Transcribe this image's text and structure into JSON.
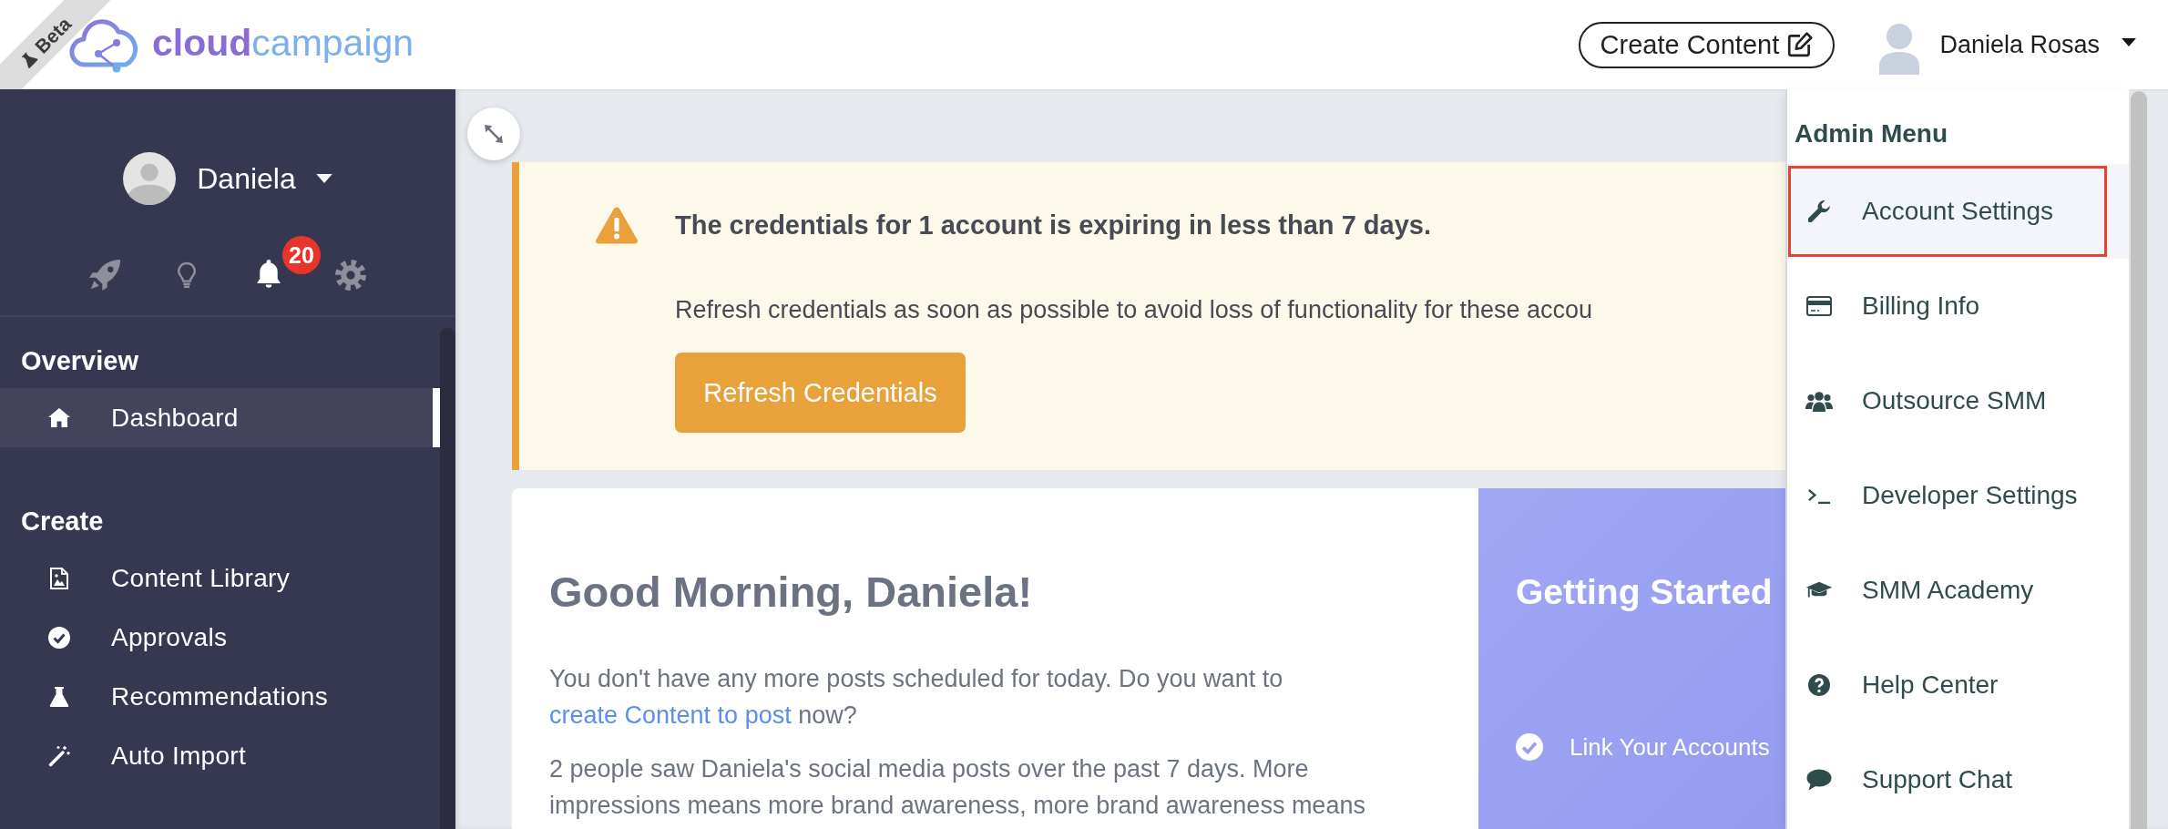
{
  "header": {
    "badge": "Beta",
    "brand": "**cloud**campaign",
    "create_button": "Create Content",
    "user_name": "Daniela Rosas"
  },
  "sidebar": {
    "profile_name": "Daniela",
    "quick_actions": [
      {
        "kind": "rocket",
        "active": false
      },
      {
        "kind": "bulb",
        "active": false
      },
      {
        "kind": "bell",
        "active": true,
        "badge": "20"
      },
      {
        "kind": "gear",
        "active": false
      }
    ],
    "sections": [
      {
        "title": "Overview",
        "items": [
          {
            "label": "Dashboard",
            "kind": "home",
            "selected": true
          }
        ]
      },
      {
        "title": "Create",
        "items": [
          {
            "label": "Content Library",
            "kind": "image",
            "selected": false
          },
          {
            "label": "Approvals",
            "kind": "check",
            "selected": false
          },
          {
            "label": "Recommendations",
            "kind": "flask",
            "selected": false
          },
          {
            "label": "Auto Import",
            "kind": "wand",
            "selected": false
          }
        ]
      }
    ]
  },
  "alert": {
    "title": "The credentials for 1 account is expiring in less than 7 days.",
    "message": "Refresh credentials as soon as possible to avoid loss of functionality for these accou",
    "button": "Refresh Credentials"
  },
  "welcome": {
    "heading": "Good Morning, Daniela!",
    "schedule": {
      "before": "You don't have any more posts scheduled for today. Do you want to",
      "link": "create Content to post",
      "after": "now?"
    },
    "reach": "2 people saw Daniela's social media posts over the past 7 days. More impressions means more brand awareness, more brand awareness means"
  },
  "getting_started": {
    "title": "Getting Started",
    "steps": [
      {
        "label": "Link Your Accounts",
        "done": true
      }
    ]
  },
  "admin_menu": {
    "title": "Admin Menu",
    "items": [
      {
        "label": "Account Settings",
        "kind": "wrench",
        "selected": true
      },
      {
        "label": "Billing Info",
        "kind": "card",
        "selected": false
      },
      {
        "label": "Outsource SMM",
        "kind": "users",
        "selected": false
      },
      {
        "label": "Developer Settings",
        "kind": "terminal",
        "selected": false
      },
      {
        "label": "SMM Academy",
        "kind": "cap",
        "selected": false
      },
      {
        "label": "Help Center",
        "kind": "question",
        "selected": false
      },
      {
        "label": "Support Chat",
        "kind": "comment",
        "selected": false
      }
    ]
  }
}
